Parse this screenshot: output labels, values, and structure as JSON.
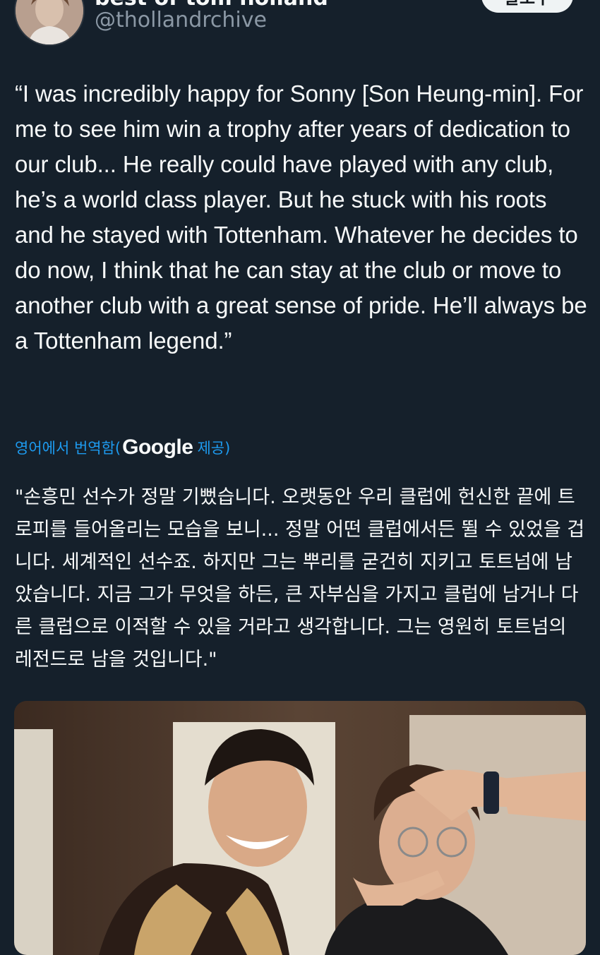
{
  "header": {
    "display_name": "best of tom holland",
    "handle": "@thollandrchive",
    "follow_button": "팔로우"
  },
  "tweet": {
    "text": "“I was incredibly happy for Sonny [Son Heung-min]. For me to see him win a trophy after years of dedication to our club... He really could have played with any club, he’s a world class player. But he stuck with his roots and he stayed with Tottenham. Whatever he decides to do now, I think that he can stay at the club or move to another club with a great sense of pride. He’ll always be a Tottenham legend.”"
  },
  "translation": {
    "label": "영어에서 번역함(",
    "brand": "Google",
    "suffix": "제공)",
    "text": "\"손흥민 선수가 정말 기뻤습니다. 오랫동안 우리 클럽에 헌신한 끝에 트로피를 들어올리는 모습을 보니... 정말 어떤 클럽에서든 뛸 수 있었을 겁니다. 세계적인 선수죠. 하지만 그는 뿌리를 굳건히 지키고 토트넘에 남았습니다. 지금 그가 무엇을 하든, 큰 자부심을 가지고 클럽에 남거나 다른 클럽으로 이적할 수 있을 거라고 생각합니다. 그는 영원히 토트넘의 레전드로 남을 것입니다.\""
  },
  "media": {
    "kind": "photo"
  },
  "colors": {
    "background": "#15202b",
    "text": "#f7f9f9",
    "secondary": "#8b98a5",
    "link": "#1d9bf0"
  }
}
